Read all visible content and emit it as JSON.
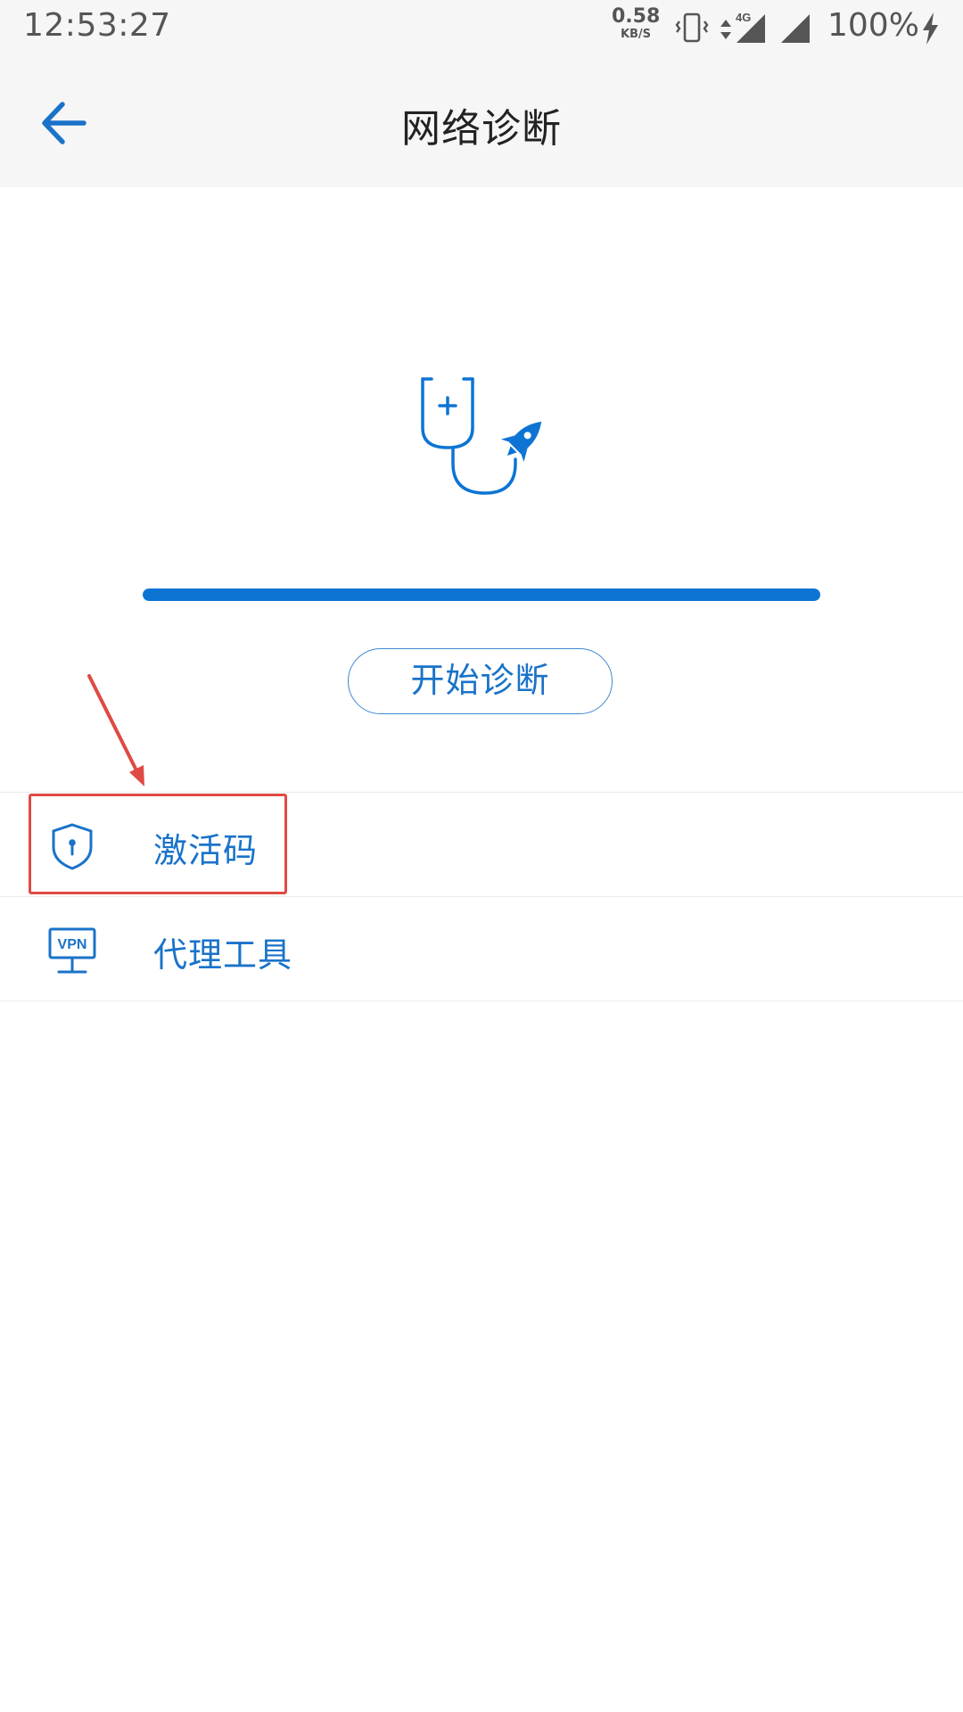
{
  "status_bar": {
    "time": "12:53:27",
    "net_speed": {
      "value": "0.58",
      "unit": "KB/S"
    },
    "icons": [
      "vibrate-icon",
      "data-activity-icon",
      "signal-4g-icon",
      "signal-icon",
      "charging-icon"
    ],
    "network_type": "4G",
    "battery": "100%"
  },
  "app_bar": {
    "back_icon": "arrow-left-icon",
    "title": "网络诊断"
  },
  "hero": {
    "illustration": "stethoscope-rocket-icon",
    "progress": 1.0,
    "start_button": "开始诊断"
  },
  "list": {
    "items": [
      {
        "icon": "shield-keyhole-icon",
        "label": "激活码"
      },
      {
        "icon": "vpn-monitor-icon",
        "label": "代理工具"
      }
    ]
  },
  "annotation": {
    "highlighted_item": "激活码"
  },
  "colors": {
    "accent": "#1a73c9",
    "progress": "#0d74d4",
    "header_bg": "#f6f6f6",
    "annotation": "#e04a44",
    "status_text": "#555555"
  }
}
